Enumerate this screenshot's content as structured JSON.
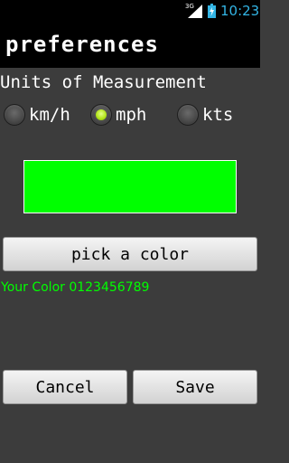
{
  "status_bar": {
    "network_type": "3G",
    "time": "10:23",
    "icons": [
      "signal-icon",
      "battery-charging-icon"
    ]
  },
  "header": {
    "title": "preferences"
  },
  "units": {
    "label": "Units of Measurement",
    "options": [
      "km/h",
      "mph",
      "kts"
    ],
    "selected": "mph"
  },
  "color": {
    "swatch": "#00ff00",
    "pick_label": "pick a color",
    "preview_text": "Your Color 0123456789"
  },
  "actions": {
    "cancel_label": "Cancel",
    "save_label": "Save"
  }
}
